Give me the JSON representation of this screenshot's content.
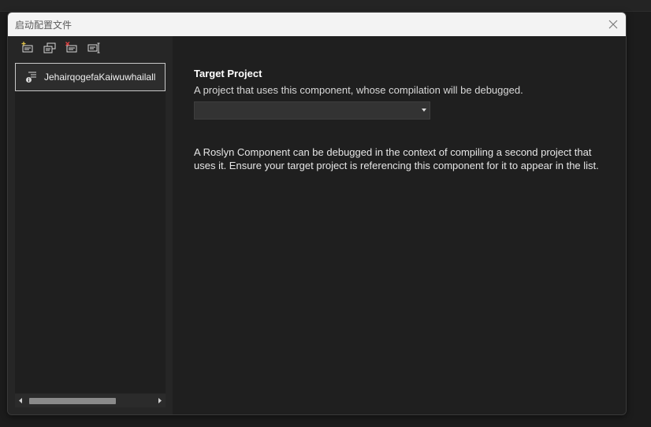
{
  "dialog": {
    "title": "启动配置文件"
  },
  "toolbar": {
    "buttons": [
      {
        "icon": "new-profile-icon",
        "label": "New profile"
      },
      {
        "icon": "copy-profile-icon",
        "label": "Copy profile"
      },
      {
        "icon": "delete-profile-icon",
        "label": "Delete profile"
      },
      {
        "icon": "rename-profile-icon",
        "label": "Rename profile"
      }
    ]
  },
  "profiles": [
    {
      "label": "JehairqogefaKaiwuwhailall",
      "selected": true
    }
  ],
  "settings": {
    "target_project_title": "Target Project",
    "target_project_desc": "A project that uses this component, whose compilation will be debugged.",
    "target_project_value": "",
    "help_text": "A Roslyn Component can be debugged in the context of compiling a second project that uses it. Ensure your target project is referencing this component for it to appear in the list."
  },
  "colors": {
    "titlebar_bg": "#f3f3f3",
    "panel_bg": "#1f1f1f",
    "sidebar_bg": "#262626",
    "selected_border": "#c8c8c8",
    "delete_accent": "#e04040"
  }
}
